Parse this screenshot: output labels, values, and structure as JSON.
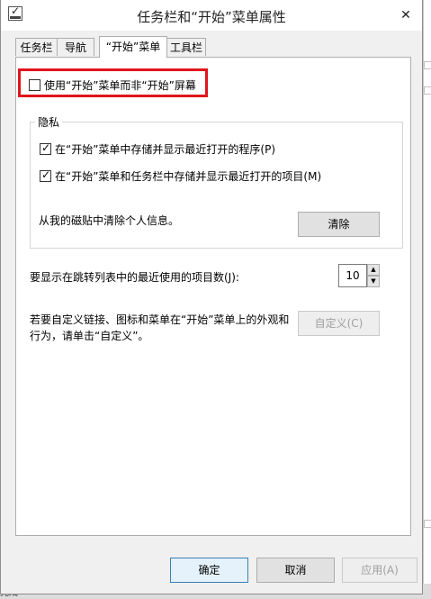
{
  "window": {
    "title": "任务栏和“开始”菜单属性",
    "close_label": "✕"
  },
  "tabs": [
    {
      "label": "任务栏",
      "active": false
    },
    {
      "label": "导航",
      "active": false
    },
    {
      "label": "“开始”菜单",
      "active": true
    },
    {
      "label": "工具栏",
      "active": false
    }
  ],
  "start_screen": {
    "label": "使用“开始”菜单而非“开始”屏幕",
    "checked": false
  },
  "privacy": {
    "title": "隐私",
    "store_programs_label": "在“开始”菜单中存储并显示最近打开的程序(P)",
    "store_programs_checked": true,
    "store_items_label": "在“开始”菜单和任务栏中存储并显示最近打开的项目(M)",
    "store_items_checked": true,
    "clear_tiles_label": "从我的磁贴中清除个人信息。",
    "clear_button": "清除"
  },
  "jump_list": {
    "label": "要显示在跳转列表中的最近使用的项目数(J):",
    "value": "10"
  },
  "customize": {
    "line1": "若要自定义链接、图标和菜单在“开始”菜单上的外观和",
    "line2": "行为，请单击“自定义”。",
    "button": "自定义(C)"
  },
  "footer": {
    "ok": "确定",
    "cancel": "取消",
    "apply": "应用(A)"
  },
  "background": {
    "bottom_text": "完成"
  }
}
